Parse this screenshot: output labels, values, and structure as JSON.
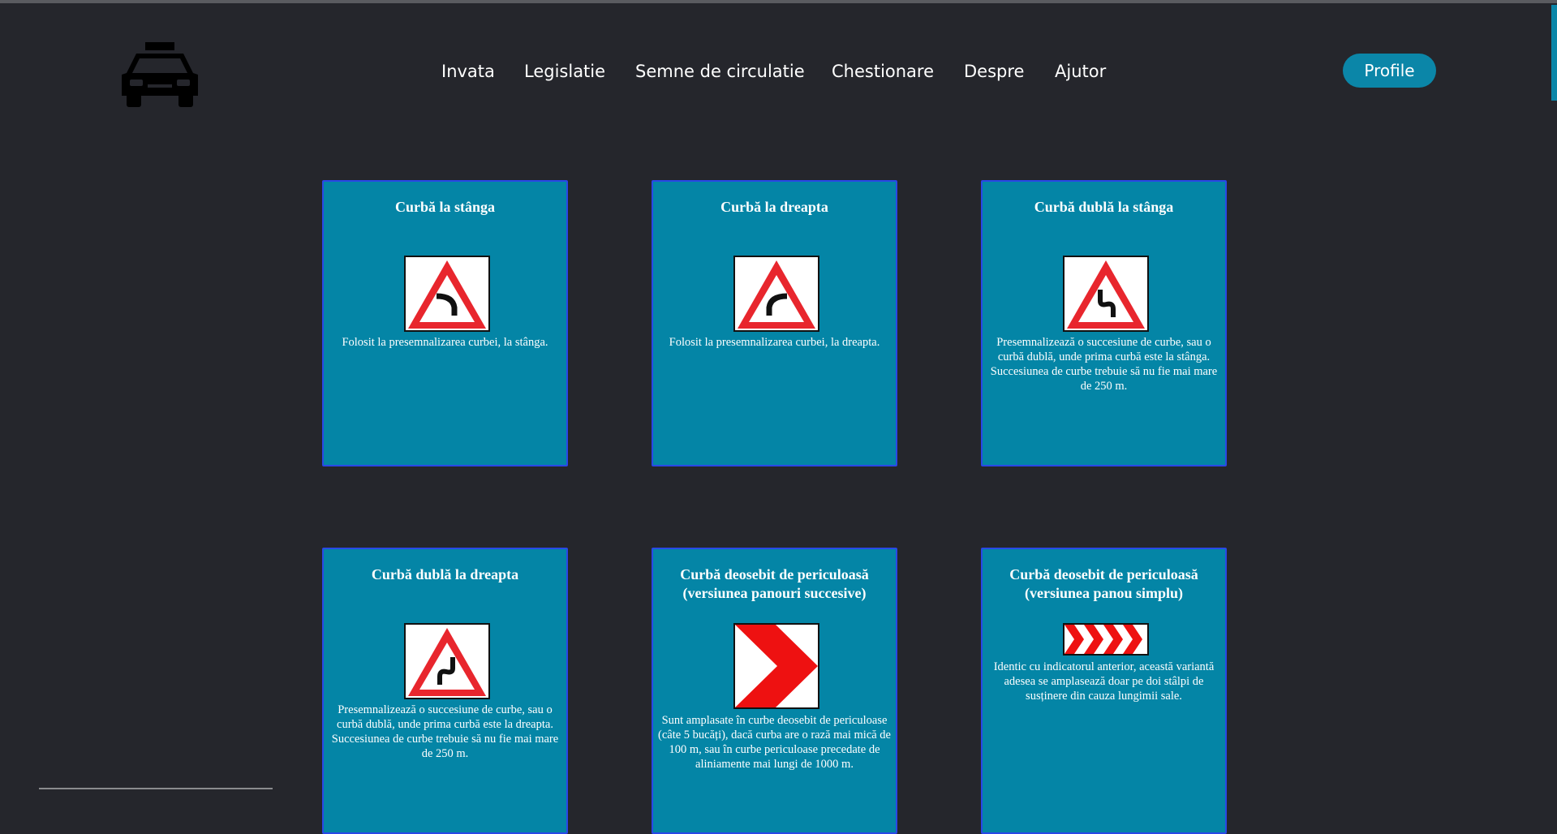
{
  "header": {
    "logo_icon": "taxi-car-icon",
    "nav": [
      {
        "label": "Invata"
      },
      {
        "label": "Legislatie"
      },
      {
        "label": "Semne de circulatie"
      },
      {
        "label": "Chestionare"
      },
      {
        "label": "Despre"
      },
      {
        "label": "Ajutor"
      }
    ],
    "profile_label": "Profile"
  },
  "colors": {
    "background": "#25262c",
    "card": "#0485a6",
    "card_border": "#2a48e6",
    "accent": "#0b86a8",
    "sign_red": "#e8262d"
  },
  "cards": [
    {
      "title": "Curbă la stânga",
      "icon": "curve-left-sign-icon",
      "description": "Folosit la presemnalizarea curbei, la stânga."
    },
    {
      "title": "Curbă la dreapta",
      "icon": "curve-right-sign-icon",
      "description": "Folosit la presemnalizarea curbei, la dreapta."
    },
    {
      "title": "Curbă dublă la stânga",
      "icon": "double-curve-left-sign-icon",
      "description": "Presemnalizează o succesiune de curbe, sau o curbă dublă, unde prima curbă este la stânga. Succesiunea de curbe trebuie să nu fie mai mare de 250 m."
    },
    {
      "title": "Curbă dublă la dreapta",
      "icon": "double-curve-right-sign-icon",
      "description": "Presemnalizează o succesiune de curbe, sau o curbă dublă, unde prima curbă este la dreapta. Succesiunea de curbe trebuie să nu fie mai mare de 250 m."
    },
    {
      "title": "Curbă deosebit de periculoasă (versiunea panouri succesive)",
      "icon": "chevron-panel-sign-icon",
      "description": "Sunt amplasate în curbe deosebit de periculoase (câte 5 bucăți), dacă curba are o rază mai mică de 100 m, sau în curbe periculoase precedate de aliniamente mai lungi de 1000 m."
    },
    {
      "title": "Curbă deosebit de periculoasă (versiunea panou simplu)",
      "icon": "chevron-strip-sign-icon",
      "description": "Identic cu indicatorul anterior, această variantă adesea se amplasează doar pe doi stâlpi de susținere din cauza lungimii sale."
    }
  ]
}
